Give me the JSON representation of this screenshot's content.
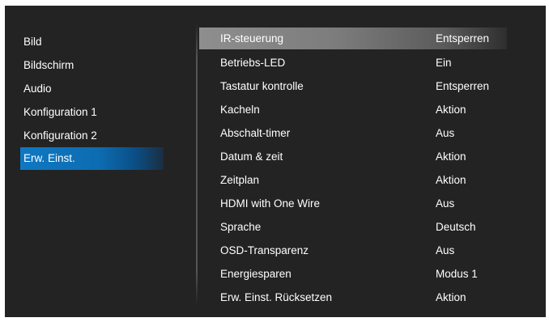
{
  "left_menu": {
    "items": [
      {
        "label": "Bild"
      },
      {
        "label": "Bildschirm"
      },
      {
        "label": "Audio"
      },
      {
        "label": "Konfiguration 1"
      },
      {
        "label": "Konfiguration 2"
      },
      {
        "label": "Erw. Einst."
      }
    ],
    "selected_index": 5
  },
  "settings": {
    "rows": [
      {
        "label": "IR-steuerung",
        "value": "Entsperren"
      },
      {
        "label": "Betriebs-LED",
        "value": "Ein"
      },
      {
        "label": "Tastatur kontrolle",
        "value": "Entsperren"
      },
      {
        "label": "Kacheln",
        "value": "Aktion"
      },
      {
        "label": "Abschalt-timer",
        "value": "Aus"
      },
      {
        "label": "Datum & zeit",
        "value": "Aktion"
      },
      {
        "label": "Zeitplan",
        "value": "Aktion"
      },
      {
        "label": "HDMI with One Wire",
        "value": "Aus"
      },
      {
        "label": "Sprache",
        "value": "Deutsch"
      },
      {
        "label": "OSD-Transparenz",
        "value": "Aus"
      },
      {
        "label": "Energiesparen",
        "value": "Modus 1"
      },
      {
        "label": "Erw. Einst. Rücksetzen",
        "value": "Aktion"
      }
    ],
    "selected_index": 0
  },
  "colors": {
    "background": "#232323",
    "left_highlight": "#0f78c2",
    "right_highlight": "#8e8e8e",
    "text": "#ffffff"
  }
}
